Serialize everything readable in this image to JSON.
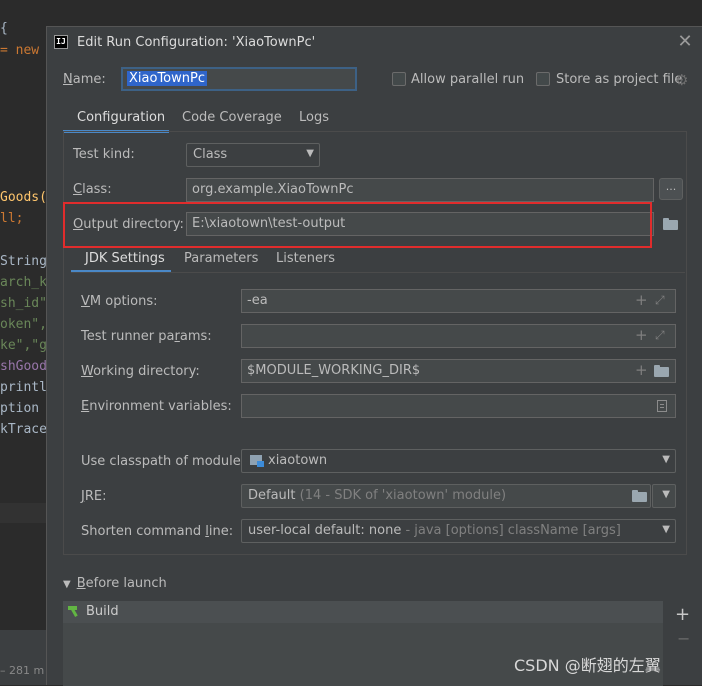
{
  "editor": {
    "lines": [
      {
        "text": "{",
        "color": "#a9b7c6"
      },
      {
        "text": "= new (",
        "color": "#cc7832"
      },
      {
        "text": "Goods()",
        "color": "#ffc66d"
      },
      {
        "text": "ll;",
        "color": "#cc7832"
      },
      {
        "text": "String",
        "color": "#a9b7c6"
      },
      {
        "text": "arch_ke",
        "color": "#6a8759"
      },
      {
        "text": "sh_id\"",
        "color": "#6a8759"
      },
      {
        "text": "oken\",",
        "color": "#6a8759"
      },
      {
        "text": "ke\",\"gu",
        "color": "#6a8759"
      },
      {
        "text": "shGoods",
        "color": "#9876aa"
      },
      {
        "text": "println",
        "color": "#a9b7c6"
      },
      {
        "text": "ption e",
        "color": "#a9b7c6"
      },
      {
        "text": "kTrace(",
        "color": "#a9b7c6"
      }
    ],
    "status_text": "– 281 m"
  },
  "dialog": {
    "title": "Edit Run Configuration: 'XiaoTownPc'",
    "app_icon_text": "IJ",
    "close_symbol": "✕",
    "name_label": "Name:",
    "name_value": "XiaoTownPc",
    "allow_parallel_label": "Allow parallel run",
    "store_project_label": "Store as project file",
    "tabs": [
      "Configuration",
      "Code Coverage",
      "Logs"
    ],
    "test_kind_label": "Test kind:",
    "test_kind_value": "Class",
    "class_label": "Class:",
    "class_value": "org.example.XiaoTownPc",
    "class_browse": "...",
    "output_dir_label": "Output directory:",
    "output_dir_value": "E:\\xiaotown\\test-output",
    "sub_tabs": [
      "JDK Settings",
      "Parameters",
      "Listeners"
    ],
    "vm_options_label": "VM options:",
    "vm_options_value": "-ea",
    "test_runner_label": "Test runner params:",
    "test_runner_value": "",
    "working_dir_label": "Working directory:",
    "working_dir_value": "$MODULE_WORKING_DIR$",
    "env_vars_label": "Environment variables:",
    "env_vars_value": "",
    "classpath_label": "Use classpath of module:",
    "classpath_value": "xiaotown",
    "jre_label": "JRE:",
    "jre_value": "Default",
    "jre_hint": "(14 - SDK of 'xiaotown' module)",
    "shorten_label": "Shorten command line:",
    "shorten_value": "user-local default: none",
    "shorten_hint": " - java [options] className [args]",
    "before_launch_label": "Before launch",
    "build_label": "Build",
    "plus_symbol": "+",
    "minus_symbol": "−"
  },
  "watermark": "CSDN @断翅的左翼",
  "colors": {
    "accent": "#4a88c7",
    "highlight_border": "#e12c2c",
    "selection": "#2f65ca"
  }
}
